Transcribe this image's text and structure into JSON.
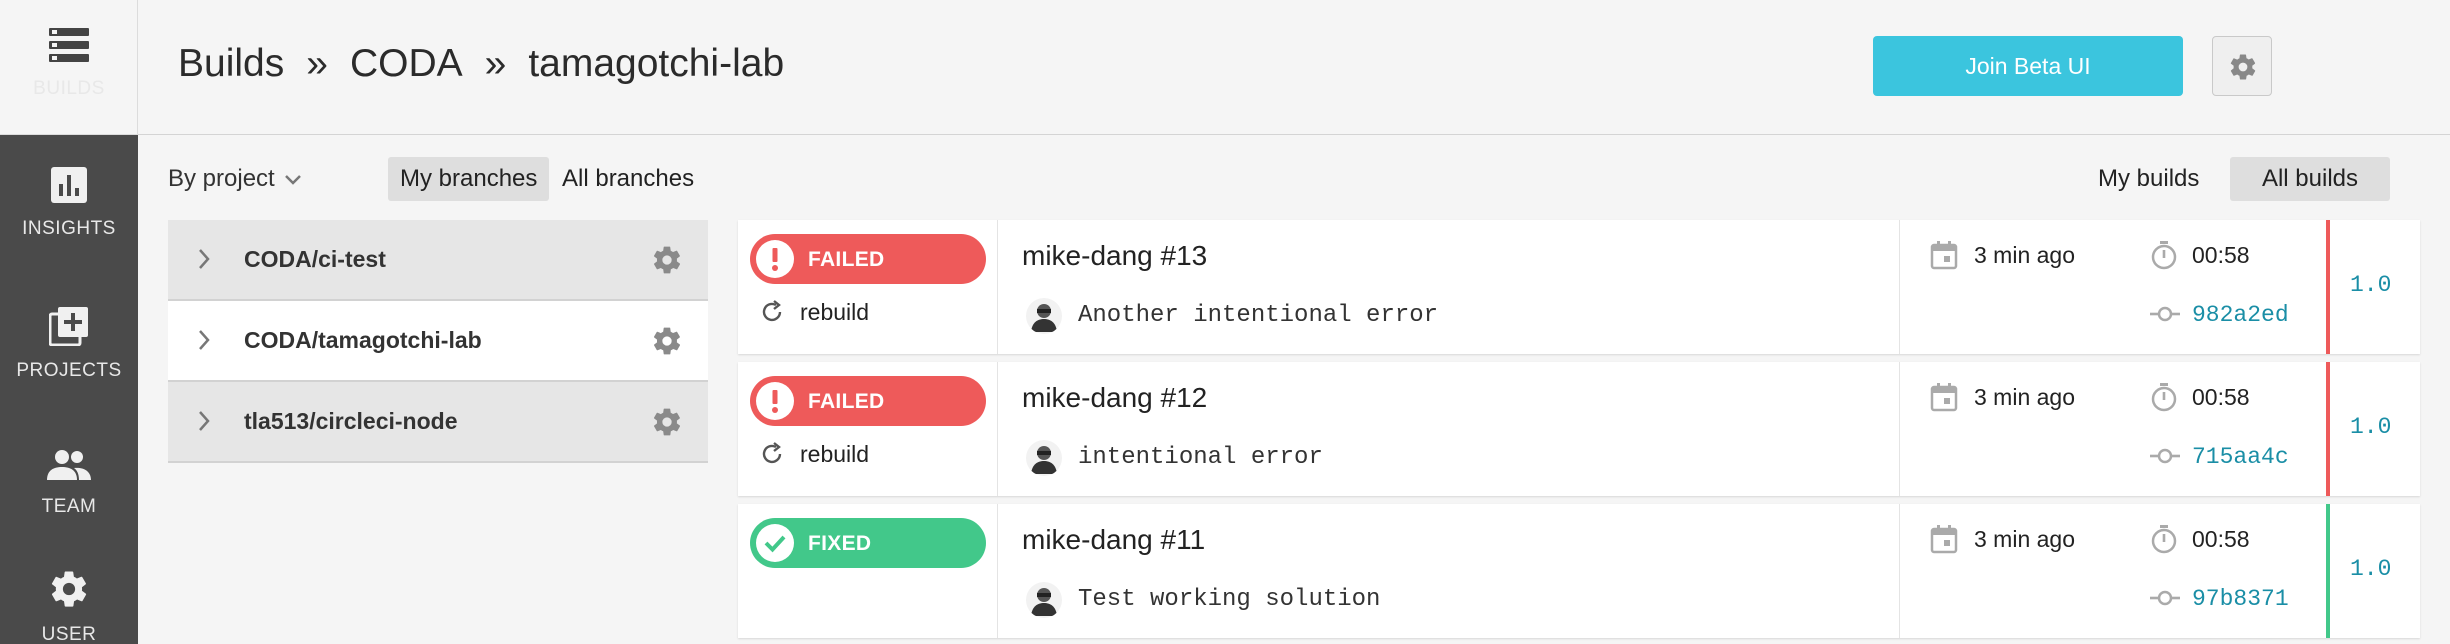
{
  "nav": {
    "builds": "BUILDS",
    "insights": "INSIGHTS",
    "projects": "PROJECTS",
    "team": "TEAM",
    "user": "USER"
  },
  "breadcrumb": [
    "Builds",
    "CODA",
    "tamagotchi-lab"
  ],
  "breadcrumb_separator": "»",
  "header": {
    "beta_button": "Join Beta UI"
  },
  "filters": {
    "by_project": "By project",
    "my_branches": "My branches",
    "all_branches": "All branches",
    "my_builds": "My builds",
    "all_builds": "All builds"
  },
  "projects": [
    {
      "name": "CODA/ci-test",
      "selected": false
    },
    {
      "name": "CODA/tamagotchi-lab",
      "selected": true
    },
    {
      "name": "tla513/circleci-node",
      "selected": false
    }
  ],
  "builds": [
    {
      "status": "FAILED",
      "action": "rebuild",
      "title": "mike-dang #13",
      "message": "Another intentional error",
      "time": "3 min ago",
      "duration": "00:58",
      "commit": "982a2ed",
      "version": "1.0"
    },
    {
      "status": "FAILED",
      "action": "rebuild",
      "title": "mike-dang #12",
      "message": "intentional error",
      "time": "3 min ago",
      "duration": "00:58",
      "commit": "715aa4c",
      "version": "1.0"
    },
    {
      "status": "FIXED",
      "action": "",
      "title": "mike-dang #11",
      "message": "Test working solution",
      "time": "3 min ago",
      "duration": "00:58",
      "commit": "97b8371",
      "version": "1.0"
    }
  ],
  "colors": {
    "failed": "#ee5a5a",
    "fixed": "#42c88a",
    "accent": "#3bc5de",
    "nav_bg": "#4a4a4a",
    "link": "#1a8ea6"
  }
}
